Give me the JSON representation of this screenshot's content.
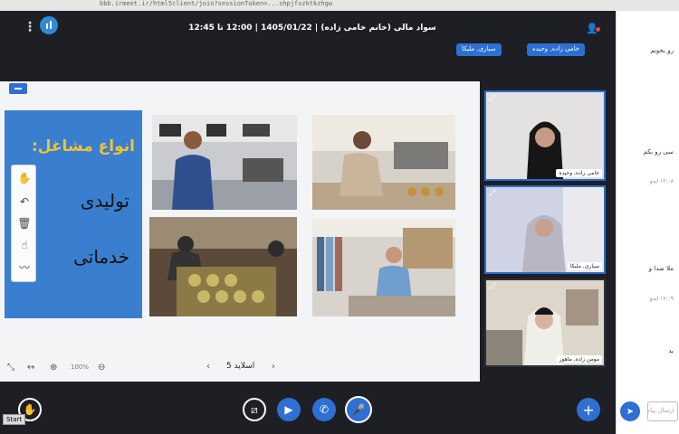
{
  "browser": {
    "url": "bbb.irmeet.ir/html5client/join?sessionToken=...shpjfxzktkzhgw"
  },
  "header": {
    "title": "سواد مالی (خانم خامی زاده) | 1405/01/22 | 12:00 تا 12:45",
    "menu_icon": "kebab-icon",
    "stats_icon": "connection-stats-icon",
    "user_icon": "user-icon"
  },
  "tags": [
    {
      "label": "خامی زاده, وحیده"
    },
    {
      "label": "سیاری, ملیکا"
    }
  ],
  "slide": {
    "title": "انواع مشاغل:",
    "line2": "تولیدی",
    "line3": "خدماتی",
    "nav_label": "اسلاید 5",
    "zoom": "100%"
  },
  "tools": [
    "hand-icon",
    "undo-icon",
    "trash-icon",
    "pointer-icon",
    "multiuser-icon"
  ],
  "cams": [
    {
      "name": "خامی زاده, وحیده"
    },
    {
      "name": "سیاری, ملیکا"
    },
    {
      "name": "مومن زاده, ماهور"
    }
  ],
  "bottom": {
    "start_label": "Start"
  },
  "chat": {
    "messages": [
      {
        "text": "رو بخونم"
      },
      {
        "text": "سی رو بکم"
      },
      {
        "text": "۱۲:۰۸ ایدو"
      },
      {
        "text": "ملا صدا و"
      },
      {
        "text": "۱۲:۰۹ ایدو"
      },
      {
        "text": "ید"
      }
    ],
    "input_placeholder": "ارسال پیام"
  },
  "colors": {
    "accent": "#2e6fd4",
    "slide_blue": "#3a7fcf",
    "slide_title": "#f1c232"
  }
}
